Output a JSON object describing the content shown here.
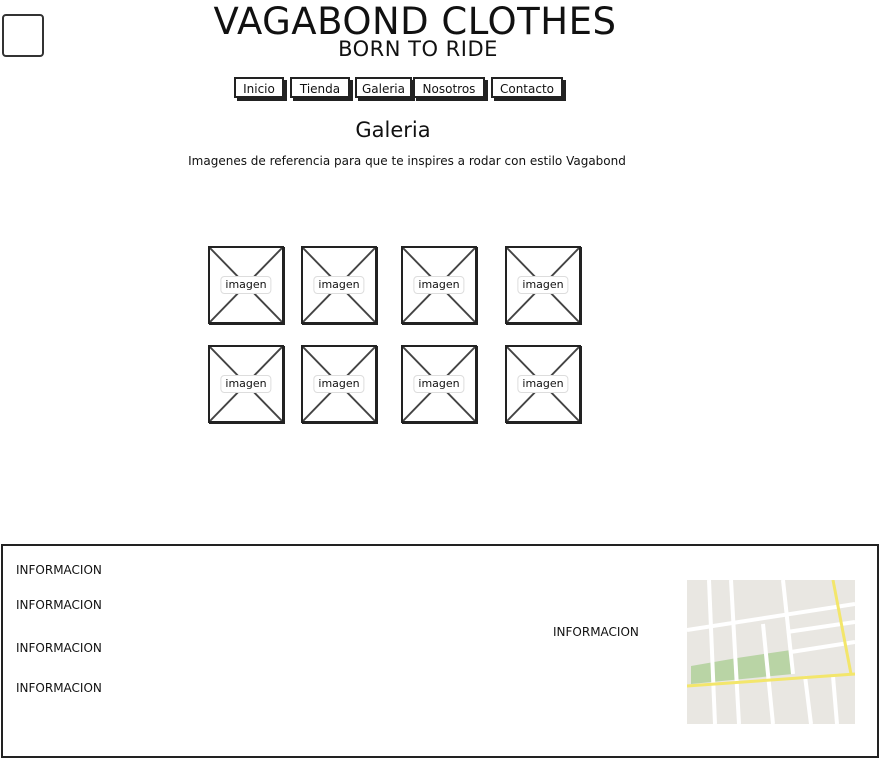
{
  "header": {
    "title": "VAGABOND CLOTHES",
    "subtitle": "BORN TO RIDE"
  },
  "nav": {
    "items": [
      {
        "label": "Inicio"
      },
      {
        "label": "Tienda"
      },
      {
        "label": "Galeria"
      },
      {
        "label": "Nosotros"
      },
      {
        "label": "Contacto"
      }
    ]
  },
  "gallery": {
    "title": "Galeria",
    "description": "Imagenes de referencia para que te inspires a rodar con estilo Vagabond",
    "images": [
      {
        "label": "imagen"
      },
      {
        "label": "imagen"
      },
      {
        "label": "imagen"
      },
      {
        "label": "imagen"
      },
      {
        "label": "imagen"
      },
      {
        "label": "imagen"
      },
      {
        "label": "imagen"
      },
      {
        "label": "imagen"
      }
    ]
  },
  "footer": {
    "left_items": [
      "INFORMACION",
      "INFORMACION",
      "INFORMACION",
      "INFORMACION"
    ],
    "center_item": "INFORMACION",
    "map_icon": "map-thumbnail"
  },
  "colors": {
    "border": "#222222",
    "map_background": "#e9e7e2",
    "map_road": "#ffffff",
    "map_highway": "#f3e66b",
    "map_park": "#b9d4a5"
  }
}
